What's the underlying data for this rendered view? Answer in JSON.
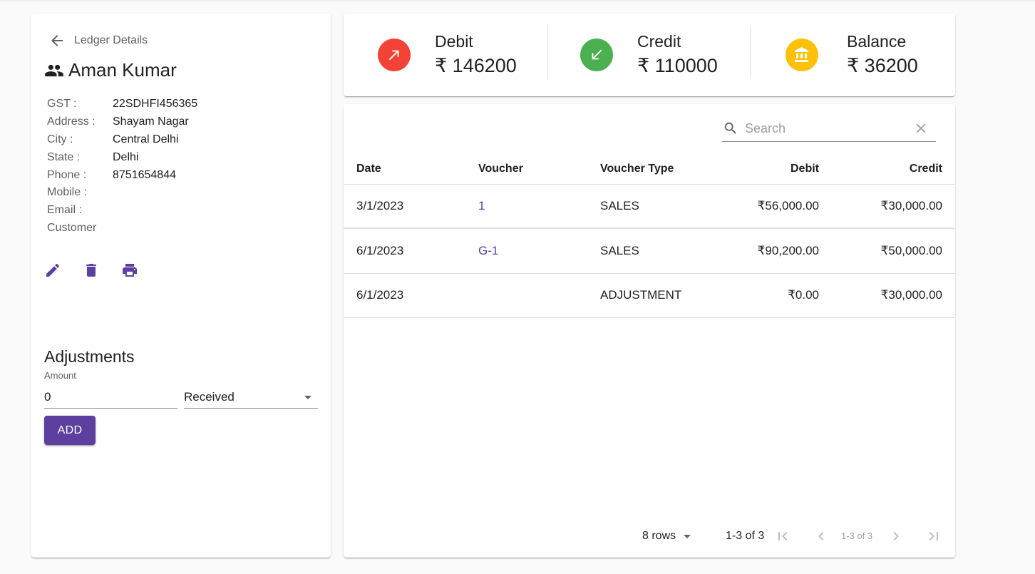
{
  "ledger": {
    "back_label": "Ledger Details",
    "name": "Aman Kumar",
    "details": [
      {
        "label": "GST :",
        "value": "22SDHFI456365"
      },
      {
        "label": "Address :",
        "value": "Shayam Nagar"
      },
      {
        "label": "City :",
        "value": "Central Delhi"
      },
      {
        "label": "State :",
        "value": "Delhi"
      },
      {
        "label": "Phone :",
        "value": "8751654844"
      },
      {
        "label": "Mobile :",
        "value": ""
      },
      {
        "label": "Email :",
        "value": ""
      }
    ],
    "category": "Customer",
    "icons": {
      "back": "arrow-back-icon",
      "people": "people-icon",
      "edit": "edit-icon",
      "delete": "delete-icon",
      "print": "print-icon"
    }
  },
  "adjustments": {
    "title": "Adjustments",
    "amount_label": "Amount",
    "amount_value": "0",
    "type_value": "Received",
    "add_label": "ADD"
  },
  "summary": {
    "debit": {
      "label": "Debit",
      "value": "₹ 146200",
      "color": "#f44336",
      "icon": "arrow-up-right-icon"
    },
    "credit": {
      "label": "Credit",
      "value": "₹ 110000",
      "color": "#4caf50",
      "icon": "arrow-down-left-icon"
    },
    "balance": {
      "label": "Balance",
      "value": "₹ 36200",
      "color": "#ffc107",
      "icon": "bank-icon"
    }
  },
  "table": {
    "search_placeholder": "Search",
    "headers": {
      "date": "Date",
      "voucher": "Voucher",
      "voucher_type": "Voucher Type",
      "debit": "Debit",
      "credit": "Credit"
    },
    "rows": [
      {
        "date": "3/1/2023",
        "voucher": "1",
        "voucher_type": "SALES",
        "debit": "₹56,000.00",
        "credit": "₹30,000.00"
      },
      {
        "date": "6/1/2023",
        "voucher": "G-1",
        "voucher_type": "SALES",
        "debit": "₹90,200.00",
        "credit": "₹50,000.00"
      },
      {
        "date": "6/1/2023",
        "voucher": "",
        "voucher_type": "ADJUSTMENT",
        "debit": "₹0.00",
        "credit": "₹30,000.00"
      }
    ]
  },
  "pagination": {
    "rows_per_page": "8 rows",
    "range": "1-3 of 3",
    "range_mini": "1-3 of 3"
  },
  "colors": {
    "primary": "#5c3f9e",
    "debit": "#f44336",
    "credit": "#4caf50",
    "balance": "#ffc107"
  }
}
